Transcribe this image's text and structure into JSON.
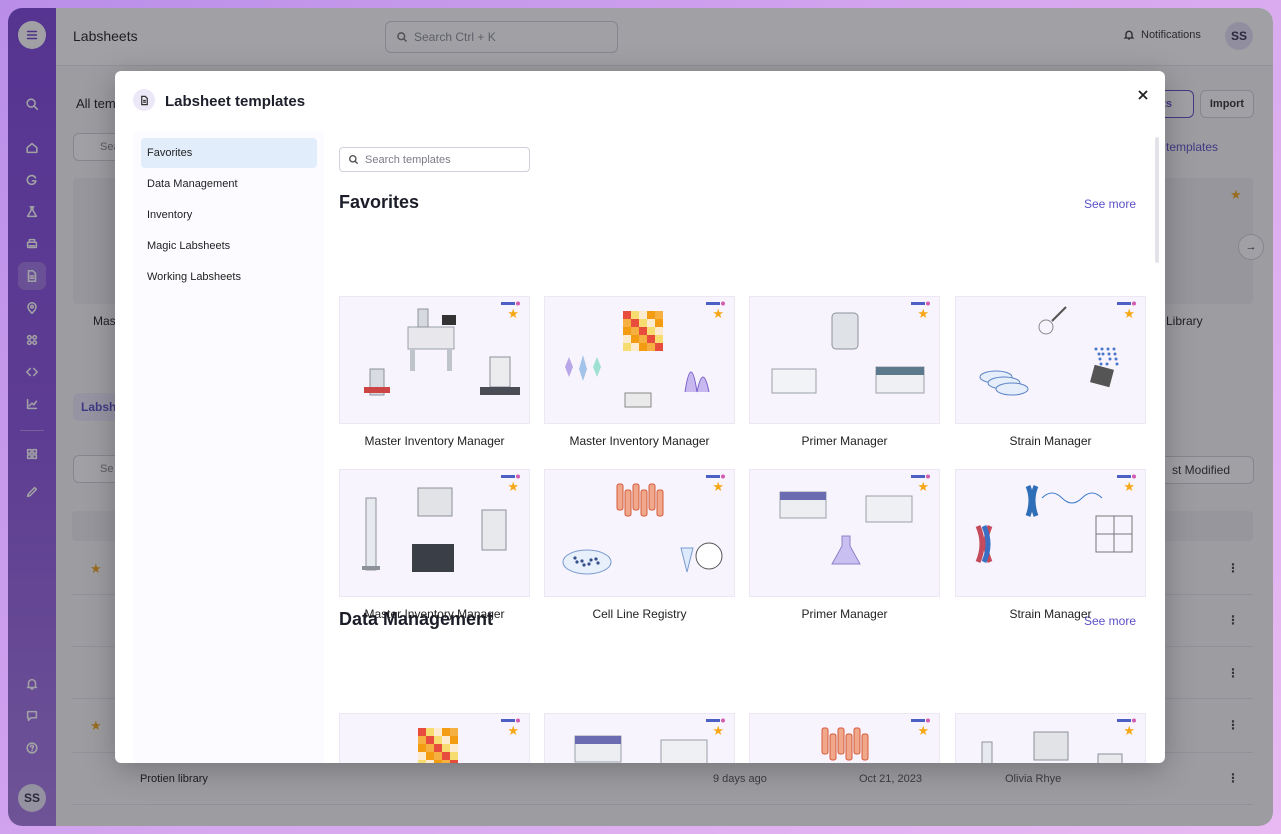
{
  "app": {
    "title": "Labsheets",
    "search_placeholder": "Search Ctrl + K",
    "notifications_label": "Notifications",
    "avatar_initials": "SS"
  },
  "background": {
    "all_templates_label": "All tem",
    "sheets_button": "ets",
    "import_button": "Import",
    "all_templates_sort": "l templates",
    "search_label": "Sea",
    "card_label_left": "Mas",
    "card_label_right": "Library",
    "labsheets_tab": "Labsh",
    "search2_label": "Se",
    "sort_label": "st Modified",
    "row_name": "Protien library",
    "row_modified": "9 days ago",
    "row_date": "Oct 21, 2023",
    "row_owner": "Olivia Rhye"
  },
  "modal": {
    "title": "Labsheet templates",
    "search_placeholder": "Search templates",
    "categories": [
      {
        "label": "Favorites"
      },
      {
        "label": "Data Management"
      },
      {
        "label": "Inventory"
      },
      {
        "label": "Magic Labsheets"
      },
      {
        "label": "Working Labsheets"
      }
    ],
    "sections": [
      {
        "title": "Favorites",
        "see_more": "See more",
        "cards": [
          {
            "label": "Master Inventory Manager",
            "art": "lab-equipment"
          },
          {
            "label": "Master Inventory Manager",
            "art": "heatmap-plots"
          },
          {
            "label": "Primer Manager",
            "art": "tank-plates"
          },
          {
            "label": "Strain Manager",
            "art": "petri-strains"
          },
          {
            "label": "Master Inventory Manager",
            "art": "column-instruments"
          },
          {
            "label": "Cell Line Registry",
            "art": "tubes-dish"
          },
          {
            "label": "Primer Manager",
            "art": "plates-flask"
          },
          {
            "label": "Strain Manager",
            "art": "chromosomes"
          }
        ]
      },
      {
        "title": "Data Management",
        "see_more": "See more",
        "cards": [
          {
            "label": "",
            "art": "heatmap-plots"
          },
          {
            "label": "",
            "art": "plates-flask"
          },
          {
            "label": "",
            "art": "tubes-dish"
          },
          {
            "label": "",
            "art": "column-instruments"
          }
        ]
      }
    ]
  },
  "colors": {
    "accent": "#5a4fc7",
    "star": "#f5a716",
    "rail": "#7d45dd",
    "active_category": "#e2edfc"
  }
}
